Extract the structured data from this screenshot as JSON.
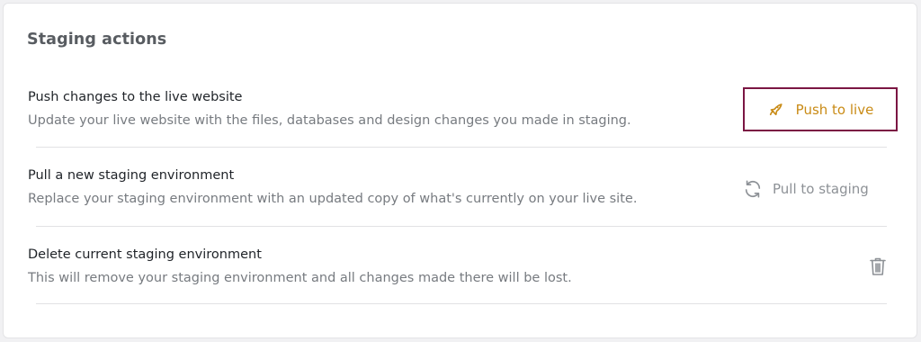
{
  "section": {
    "title": "Staging actions"
  },
  "actions": [
    {
      "title": "Push changes to the live website",
      "description": "Update your live website with the files, databases and design changes you made in staging.",
      "button_label": "Push to live",
      "icon": "rocket-icon"
    },
    {
      "title": "Pull a new staging environment",
      "description": "Replace your staging environment with an updated copy of what's currently on your live site.",
      "button_label": "Pull to staging",
      "icon": "refresh-icon"
    },
    {
      "title": "Delete current staging environment",
      "description": "This will remove your staging environment and all changes made there will be lost.",
      "icon": "trash-icon"
    }
  ],
  "colors": {
    "accent": "#c98b16",
    "focus_border": "#7b1643",
    "muted": "#8d9196"
  }
}
